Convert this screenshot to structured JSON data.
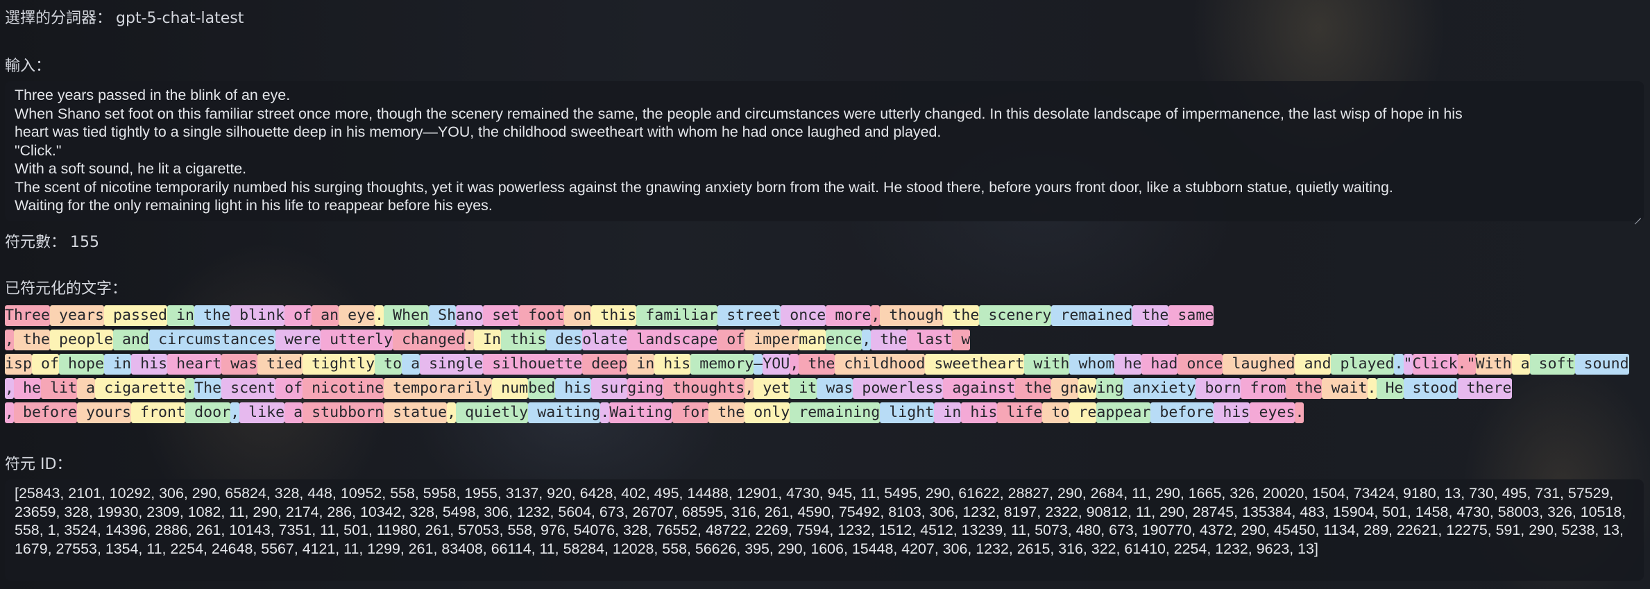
{
  "tokenizer": {
    "label": "選擇的分詞器：",
    "value": "gpt-5-chat-latest"
  },
  "input": {
    "label": "輸入：",
    "lines": [
      "Three years passed in the blink of an eye.",
      "When Shano set foot on this familiar street once more, though the scenery remained the same, the people and circumstances were utterly changed. In this desolate landscape of impermanence, the last wisp of hope in his",
      "heart was tied tightly to a single silhouette deep in his memory—YOU, the childhood sweetheart with whom he had once laughed and played.",
      "\"Click.\"",
      "With a soft sound, he lit a cigarette.",
      "The scent of nicotine temporarily numbed his surging thoughts, yet it was powerless against the gnawing anxiety born from the wait. He stood there, before yours front door, like a stubborn statue, quietly waiting.",
      "Waiting for the only remaining light in his life to reappear before his eyes."
    ]
  },
  "token_count": {
    "label": "符元數：",
    "value": "155"
  },
  "tokenized": {
    "label": "已符元化的文字：",
    "colors": [
      "#f6a6b6",
      "#fbd3b2",
      "#fdf3b5",
      "#bdebc1",
      "#b8dcf6",
      "#e6b9ee",
      "#f4a9d6"
    ],
    "tokens": [
      "Three",
      " years",
      " passed",
      " in",
      " the",
      " blink",
      " of",
      " an",
      " eye",
      ".",
      " When",
      " Sh",
      "ano",
      " set",
      " foot",
      " on",
      " this",
      " familiar",
      " street",
      " once",
      " more",
      ",",
      " though",
      " the",
      " scenery",
      " remained",
      " the",
      " same",
      ",",
      " the",
      " people",
      " and",
      " circumstances",
      " were",
      " utterly",
      " changed",
      ".",
      " In",
      " this",
      " des",
      "olate",
      " landscape",
      " of",
      " imper",
      "man",
      "ence",
      ",",
      " the",
      " last",
      " w",
      "isp",
      " of",
      " hope",
      " in",
      " his",
      " heart",
      " was",
      " tied",
      " tightly",
      " to",
      " a",
      " single",
      " silhouette",
      " deep",
      " in",
      " his",
      " memory",
      "—",
      "YOU",
      ",",
      " the",
      " childhood",
      " sweetheart",
      " with",
      " whom",
      " he",
      " had",
      " once",
      " laughed",
      " and",
      " played",
      ".",
      "\"",
      "Click",
      ".\"",
      "With",
      " a",
      " soft",
      " sound",
      ",",
      " he",
      " lit",
      " a",
      " cigarette",
      ".",
      "The",
      " scent",
      " of",
      " nicotine",
      " temporarily",
      " num",
      "bed",
      " his",
      " sur",
      "ging",
      " thoughts",
      ",",
      " yet",
      " it",
      " was",
      " powerless",
      " against",
      " the",
      " gn",
      "aw",
      "ing",
      " anxiety",
      " born",
      " from",
      " the",
      " wait",
      ".",
      " He",
      " stood",
      " there",
      ",",
      " before",
      " yours",
      " front",
      " door",
      ",",
      " like",
      " a",
      " stubborn",
      " statue",
      ",",
      " quietly",
      " waiting",
      ".",
      "Waiting",
      " for",
      " the",
      " only",
      " remaining",
      " light",
      " in",
      " his",
      " life",
      " to",
      " re",
      "appear",
      " before",
      " his",
      " eyes",
      "."
    ]
  },
  "token_ids": {
    "label": "符元 ID：",
    "value": "[25843, 2101, 10292, 306, 290, 65824, 328, 448, 10952, 558, 5958, 1955, 3137, 920, 6428, 402, 495, 14488, 12901, 4730, 945, 11, 5495, 290, 61622, 28827, 290, 2684, 11, 290, 1665, 326, 20020, 1504, 73424, 9180, 13, 730, 495, 731, 57529, 23659, 328, 19930, 2309, 1082, 11, 290, 2174, 286, 10342, 328, 5498, 306, 1232, 5604, 673, 26707, 68595, 316, 261, 4590, 75492, 8103, 306, 1232, 8197, 2322, 90812, 11, 290, 28745, 135384, 483, 15904, 501, 1458, 4730, 58003, 326, 10518, 558, 1, 3524, 14396, 2886, 261, 10143, 7351, 11, 501, 11980, 261, 57053, 558, 976, 54076, 328, 76552, 48722, 2269, 7594, 1232, 1512, 4512, 13239, 11, 5073, 480, 673, 190770, 4372, 290, 45450, 1134, 289, 22621, 12275, 591, 290, 5238, 13, 1679, 27553, 1354, 11, 2254, 24648, 5567, 4121, 11, 1299, 261, 83408, 66114, 11, 58284, 12028, 558, 56626, 395, 290, 1606, 15448, 4207, 306, 1232, 2615, 316, 322, 61410, 2254, 1232, 9623, 13]"
  }
}
